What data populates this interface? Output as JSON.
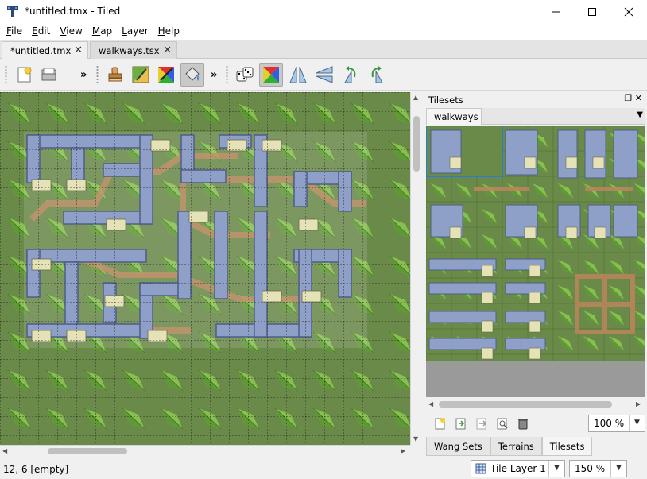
{
  "window": {
    "title": "*untitled.tmx - Tiled",
    "minimize_glyph": "minimize",
    "maximize_glyph": "maximize",
    "close_glyph": "close"
  },
  "menu": {
    "items": [
      {
        "mnemonic": "F",
        "rest": "ile"
      },
      {
        "mnemonic": "E",
        "rest": "dit"
      },
      {
        "mnemonic": "V",
        "rest": "iew"
      },
      {
        "mnemonic": "M",
        "rest": "ap"
      },
      {
        "mnemonic": "L",
        "rest": "ayer"
      },
      {
        "mnemonic": "H",
        "rest": "elp"
      }
    ]
  },
  "tabs": [
    {
      "label": "*untitled.tmx",
      "active": true
    },
    {
      "label": "walkways.tsx",
      "active": false
    }
  ],
  "toolbar": {
    "overflow_glyph": "»",
    "icons": [
      "new-map-icon",
      "open-icon",
      "stamp-brush-icon",
      "terrain-brush-icon",
      "wang-brush-icon",
      "bucket-fill-icon",
      "random-mode-icon",
      "wang-fill-mode-icon",
      "flip-horizontal-icon",
      "flip-vertical-icon",
      "rotate-left-icon",
      "rotate-right-icon"
    ]
  },
  "tilesets_panel": {
    "title": "Tilesets",
    "tab": "walkways",
    "zoom": "100 %",
    "bottom_tabs": [
      {
        "label": "Wang Sets",
        "active": false
      },
      {
        "label": "Terrains",
        "active": false
      },
      {
        "label": "Tilesets",
        "active": true
      }
    ]
  },
  "status": {
    "position": "12, 6 [empty]",
    "layer": "Tile Layer 1",
    "zoom": "150 %"
  },
  "colors": {
    "grass": "#6a8a4a",
    "walkway": "#8fa0c8",
    "path": "#b8865a",
    "leaf": "#7ab848"
  }
}
